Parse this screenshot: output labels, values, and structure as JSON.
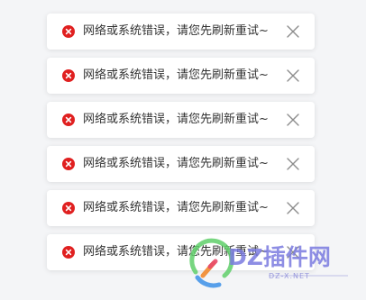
{
  "colors": {
    "error": "#e02020",
    "text": "#333333",
    "close": "#8c8c8c",
    "watermark": "#7b7be0"
  },
  "toasts": [
    {
      "message": "网络或系统错误，请您先刷新重试~",
      "icon": "error-circle-icon",
      "close_icon": "close-icon"
    },
    {
      "message": "网络或系统错误，请您先刷新重试~",
      "icon": "error-circle-icon",
      "close_icon": "close-icon"
    },
    {
      "message": "网络或系统错误，请您先刷新重试~",
      "icon": "error-circle-icon",
      "close_icon": "close-icon"
    },
    {
      "message": "网络或系统错误，请您先刷新重试~",
      "icon": "error-circle-icon",
      "close_icon": "close-icon"
    },
    {
      "message": "网络或系统错误，请您先刷新重试~",
      "icon": "error-circle-icon",
      "close_icon": "close-icon"
    },
    {
      "message": "网络或系统错误，请您先刷新重试~",
      "icon": "error-circle-icon",
      "close_icon": "close-icon"
    }
  ],
  "watermark": {
    "name": "DZ插件网",
    "url": "DZ-X.NET"
  }
}
